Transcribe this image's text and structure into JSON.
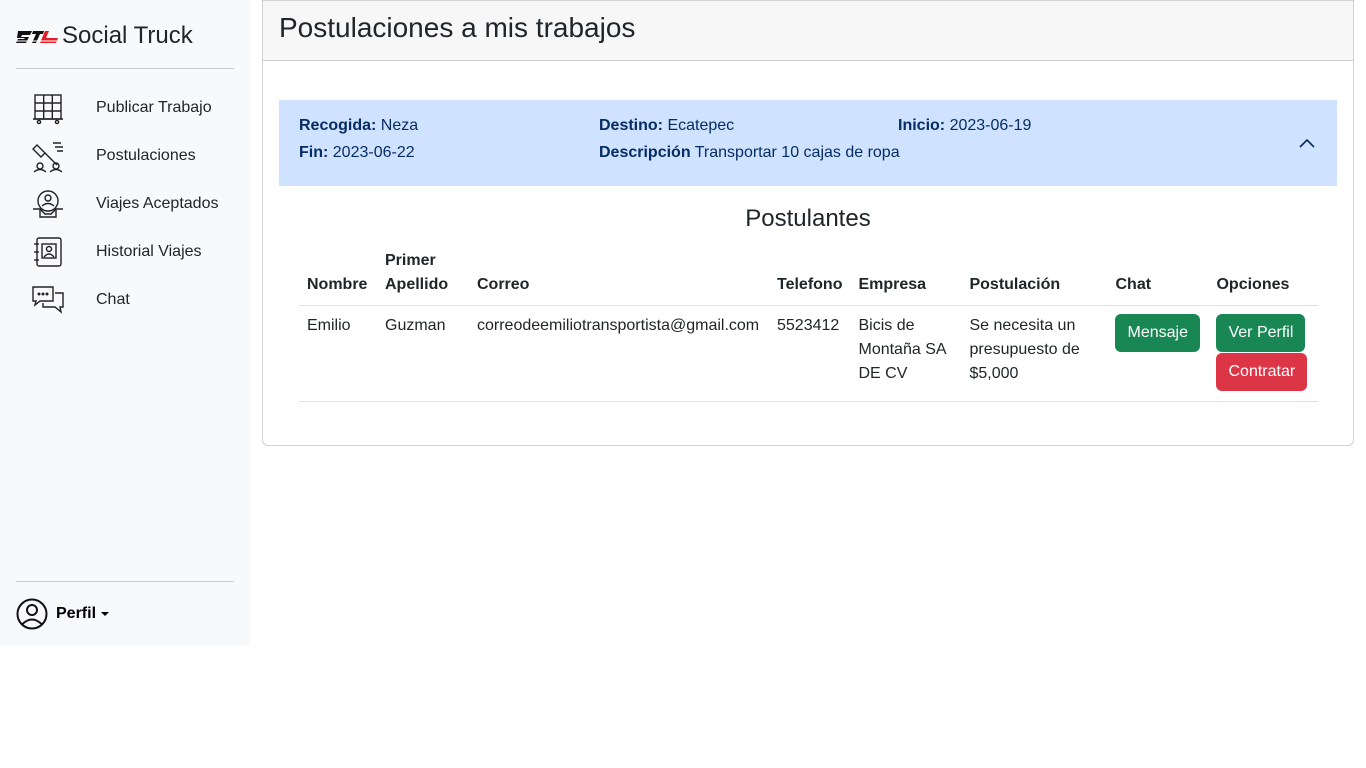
{
  "app": {
    "name": "Social Truck"
  },
  "sidebar": {
    "items": [
      {
        "label": "Publicar Trabajo",
        "icon": "warehouse-shelves-icon"
      },
      {
        "label": "Postulaciones",
        "icon": "applications-icon"
      },
      {
        "label": "Viajes Aceptados",
        "icon": "handshake-gear-icon"
      },
      {
        "label": "Historial Viajes",
        "icon": "contact-book-icon"
      },
      {
        "label": "Chat",
        "icon": "chat-bubbles-icon"
      }
    ],
    "profile_label": "Perfil",
    "profile_icon": "user-circle-icon"
  },
  "main": {
    "title": "Postulaciones a mis trabajos",
    "job": {
      "pickup_label": "Recogida:",
      "pickup_value": "Neza",
      "destination_label": "Destino:",
      "destination_value": "Ecatepec",
      "start_label": "Inicio:",
      "start_value": "2023-06-19",
      "end_label": "Fin:",
      "end_value": "2023-06-22",
      "description_label": "Descripción",
      "description_value": "Transportar 10 cajas de ropa"
    },
    "applicants_title": "Postulantes",
    "table": {
      "headers": {
        "nombre": "Nombre",
        "primer_apellido_1": "Primer",
        "primer_apellido_2": "Apellido",
        "correo": "Correo",
        "telefono": "Telefono",
        "empresa": "Empresa",
        "postulacion": "Postulación",
        "chat": "Chat",
        "opciones": "Opciones"
      },
      "rows": [
        {
          "nombre": "Emilio",
          "apellido": "Guzman",
          "correo": "correodeemiliotransportista@gmail.com",
          "telefono": "5523412",
          "empresa": "Bicis de Montaña SA DE CV",
          "postulacion": "Se necesita un presupuesto de $5,000",
          "chat_button": "Mensaje",
          "ver_perfil_button": "Ver Perfil",
          "contratar_button": "Contratar"
        }
      ]
    }
  },
  "colors": {
    "sidebar_bg": "#f8f9fa",
    "accordion_bg": "#cfe2ff",
    "accordion_text": "#052c65",
    "success": "#198754",
    "danger": "#dc3545"
  }
}
